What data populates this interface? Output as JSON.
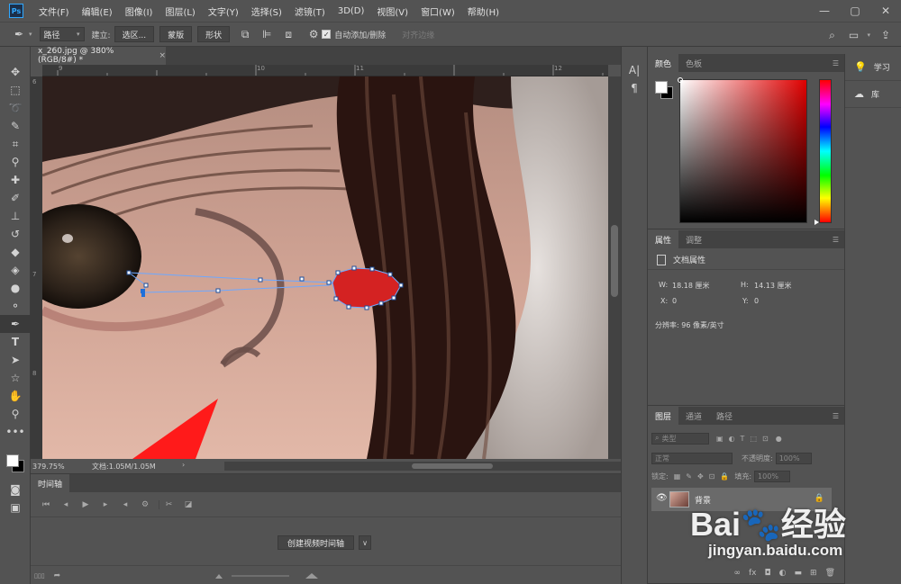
{
  "app": {
    "logo": "Ps",
    "menu": [
      "文件(F)",
      "编辑(E)",
      "图像(I)",
      "图层(L)",
      "文字(Y)",
      "选择(S)",
      "滤镜(T)",
      "3D(D)",
      "视图(V)",
      "窗口(W)",
      "帮助(H)"
    ],
    "window_controls": [
      "—",
      "▢",
      "✕"
    ]
  },
  "options_bar": {
    "mode_select": "路径",
    "make_label": "建立:",
    "selection_btn": "选区...",
    "mask_btn": "蒙版",
    "shape_btn": "形状",
    "auto_add_delete": "自动添加/删除",
    "align_edges": "对齐边缘"
  },
  "document": {
    "tab_title": "x_260.jpg @ 380%(RGB/8#) *",
    "tab_close": "×",
    "ruler_h": [
      "9",
      "10",
      "11",
      "12"
    ],
    "ruler_v": [
      "6",
      "7",
      "8"
    ],
    "zoom": "379.75%",
    "doc_info": "文档:1.05M/1.05M"
  },
  "timeline": {
    "tab": "时间轴",
    "create_video_btn": "创建视频时间轴",
    "dropdown_arrow": "∨"
  },
  "color_panel": {
    "tabs": [
      "颜色",
      "色板"
    ],
    "fg_color": "#ffffff",
    "bg_color": "#000000",
    "hue_color": "#e00000"
  },
  "properties_panel": {
    "tabs": [
      "属性",
      "调整"
    ],
    "header": "文档属性",
    "w_label": "W:",
    "w_value": "18.18 厘米",
    "h_label": "H:",
    "h_value": "14.13 厘米",
    "x_label": "X:",
    "x_value": "0",
    "y_label": "Y:",
    "y_value": "0",
    "resolution": "分辨率: 96 像素/英寸"
  },
  "layers_panel": {
    "tabs": [
      "图层",
      "通道",
      "路径"
    ],
    "filter_kind": "类型",
    "blend_mode": "正常",
    "opacity_label": "不透明度:",
    "opacity_value": "100%",
    "lock_label": "锁定:",
    "fill_label": "填充:",
    "fill_value": "100%",
    "layer_name": "背景",
    "footer_icons": [
      "∞",
      "fx",
      "◘",
      "◐",
      "▬",
      "⊞",
      "🗑"
    ]
  },
  "learn_panel": {
    "items": [
      {
        "icon": "lightbulb-icon",
        "label": "学习"
      },
      {
        "icon": "libraries-icon",
        "label": "库"
      }
    ]
  },
  "watermark": {
    "logo_text": "Bai🐾经验",
    "url": "jingyan.baidu.com"
  }
}
